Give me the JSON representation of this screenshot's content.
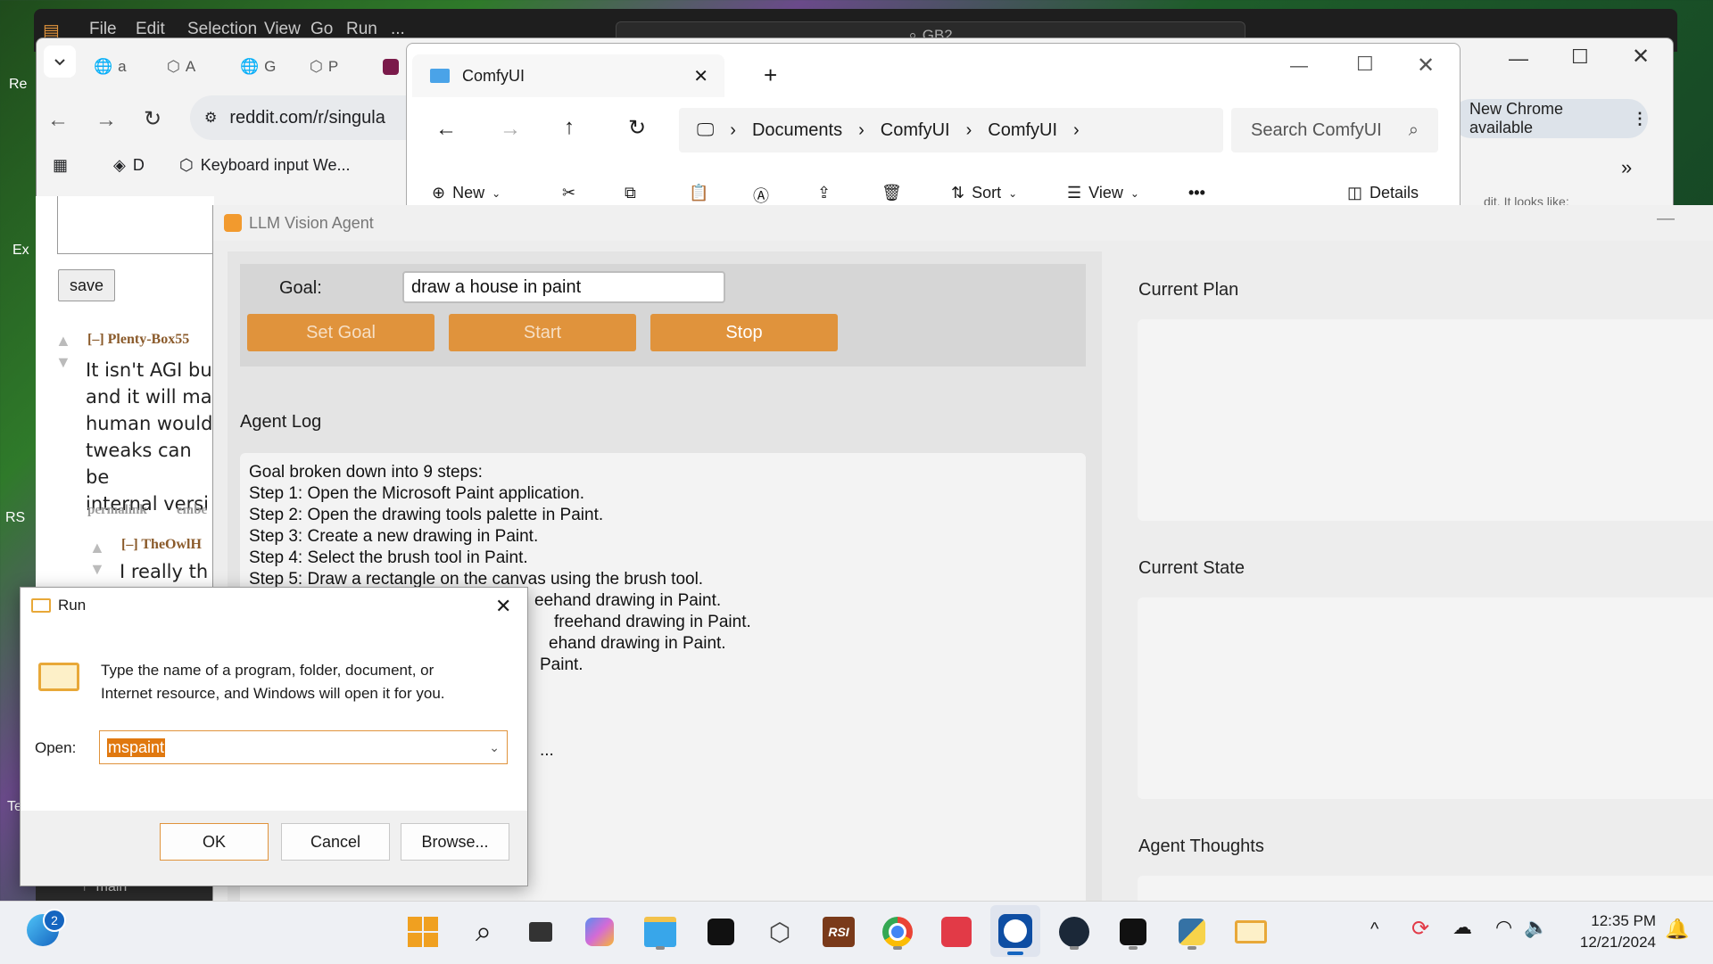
{
  "vscode": {
    "menu": [
      "File",
      "Edit",
      "Selection",
      "View",
      "Go",
      "Run",
      "..."
    ],
    "search": "GB2"
  },
  "chrome": {
    "tabs": [
      "a",
      "A",
      "G",
      "P"
    ],
    "url": "reddit.com/r/singula",
    "new_chrome": "New Chrome available",
    "bookmarks": [
      "D",
      "Keyboard input We..."
    ]
  },
  "reddit": {
    "save": "save",
    "comment1_user": "[–] Plenty-Box55",
    "comment1_lines": [
      "It isn't AGI bu",
      "and it will ma",
      "human would",
      "tweaks can be",
      "internal versi"
    ],
    "links": [
      "permalink",
      "embe"
    ],
    "comment2_user": "[–] TheOwlH",
    "comment2_line": "I really th",
    "left_edge": [
      "Re",
      "Ex",
      "RS",
      "Te"
    ],
    "git_branch": "main",
    "peek_text": "dit. It looks like:"
  },
  "explorer": {
    "tab_title": "ComfyUI",
    "path": [
      "Documents",
      "ComfyUI",
      "ComfyUI"
    ],
    "search_placeholder": "Search ComfyUI",
    "toolbar": {
      "new": "New",
      "sort": "Sort",
      "view": "View",
      "details": "Details"
    }
  },
  "agent": {
    "title": "LLM Vision Agent",
    "goal_label": "Goal:",
    "goal_value": "draw a house in paint",
    "buttons": {
      "set_goal": "Set Goal",
      "start": "Start",
      "stop": "Stop"
    },
    "log_heading": "Agent Log",
    "log_lines": [
      "Goal broken down into 9 steps:",
      "Step 1: Open the Microsoft Paint application.",
      "Step 2: Open the drawing tools palette in Paint.",
      "Step 3: Create a new drawing in Paint.",
      "Step 4: Select the brush tool in Paint.",
      "Step 5: Draw a rectangle on the canvas using the brush tool."
    ],
    "log_fragments": [
      "eehand drawing in Paint.",
      "freehand drawing in Paint.",
      "ehand drawing in Paint.",
      "Paint.",
      "..."
    ],
    "plan_heading": "Current Plan",
    "state_heading": "Current State",
    "thoughts_heading": "Agent Thoughts"
  },
  "run_dialog": {
    "title": "Run",
    "description_line1": "Type the name of a program, folder, document, or",
    "description_line2": "Internet resource, and Windows will open it for you.",
    "open_label": "Open:",
    "open_value": "mspaint",
    "ok": "OK",
    "cancel": "Cancel",
    "browse": "Browse..."
  },
  "taskbar": {
    "notification_count": "2",
    "time": "12:35 PM",
    "date": "12/21/2024",
    "icons": [
      "start-icon",
      "search-icon",
      "task-view-icon",
      "copilot-icon",
      "file-explorer-icon",
      "app-icon",
      "unity-icon",
      "rsi-icon",
      "chrome-icon",
      "app-red-icon",
      "teamviewer-icon",
      "steam-icon",
      "app-dark-icon",
      "python-icon",
      "run-icon"
    ]
  },
  "colors": {
    "accent_orange": "#e0933c",
    "selection": "#e0780f"
  }
}
